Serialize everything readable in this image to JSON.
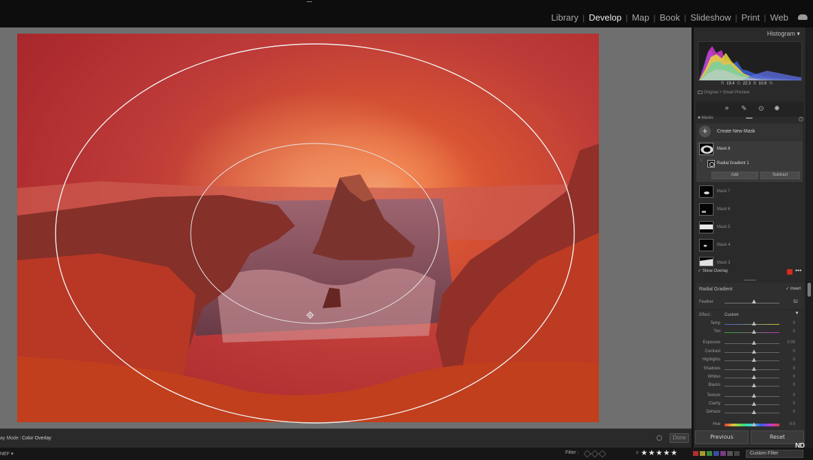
{
  "modules": {
    "library": "Library",
    "develop": "Develop",
    "map": "Map",
    "book": "Book",
    "slideshow": "Slideshow",
    "print": "Print",
    "web": "Web",
    "separator": "|"
  },
  "histogram": {
    "title": "Histogram",
    "r_label": "R",
    "r_value": "19.4",
    "g_label": "G",
    "g_value": "22.3",
    "b_label": "B",
    "b_value": "10.6",
    "unit": "%",
    "preview": "Original + Smart Preview"
  },
  "masks": {
    "header": "Masks",
    "create": "Create New Mask",
    "active_mask": "Mask 8",
    "component": "Radial Gradient 1",
    "add": "Add",
    "subtract": "Subtract",
    "list": [
      "Mask 7",
      "Mask 6",
      "Mask 5",
      "Mask 4",
      "Mask 3"
    ],
    "show_overlay": "Show Overlay",
    "overlay_color": "#d42b1f"
  },
  "radial": {
    "title": "Radial Gradient",
    "invert": "Invert",
    "feather_label": "Feather",
    "feather_value": "52"
  },
  "effect": {
    "label": "Effect :",
    "value": "Custom",
    "sliders": [
      {
        "label": "Temp",
        "value": "0",
        "track": "temp"
      },
      {
        "label": "Tint",
        "value": "0",
        "track": "tint"
      },
      {
        "label": "Exposure",
        "value": "0.00",
        "track": "plain"
      },
      {
        "label": "Contrast",
        "value": "0",
        "track": "plain"
      },
      {
        "label": "Highlights",
        "value": "0",
        "track": "plain"
      },
      {
        "label": "Shadows",
        "value": "0",
        "track": "plain"
      },
      {
        "label": "Whites",
        "value": "0",
        "track": "plain"
      },
      {
        "label": "Blacks",
        "value": "0",
        "track": "plain"
      },
      {
        "label": "Texture",
        "value": "0",
        "track": "plain"
      },
      {
        "label": "Clarity",
        "value": "0",
        "track": "plain"
      },
      {
        "label": "Dehaze",
        "value": "0",
        "track": "plain"
      },
      {
        "label": "Hue",
        "value": "0.0",
        "track": "hue"
      }
    ]
  },
  "buttons": {
    "previous": "Previous",
    "reset": "Reset",
    "done": "Done"
  },
  "toolbar": {
    "overlay_mode_label": "ay Mode :",
    "overlay_mode_value": "Color Overlay"
  },
  "filmstrip": {
    "file": "NEF ▾",
    "filter_label": "Filter :",
    "rating_op": "≥",
    "stars": "★★★★★",
    "custom_filter": "Custom Filter",
    "label_colors": [
      "#b03030",
      "#a59a2a",
      "#3a8a3a",
      "#3a4fa0",
      "#7a3a8a",
      "#555555",
      "#444444"
    ]
  },
  "watermark": "ND"
}
